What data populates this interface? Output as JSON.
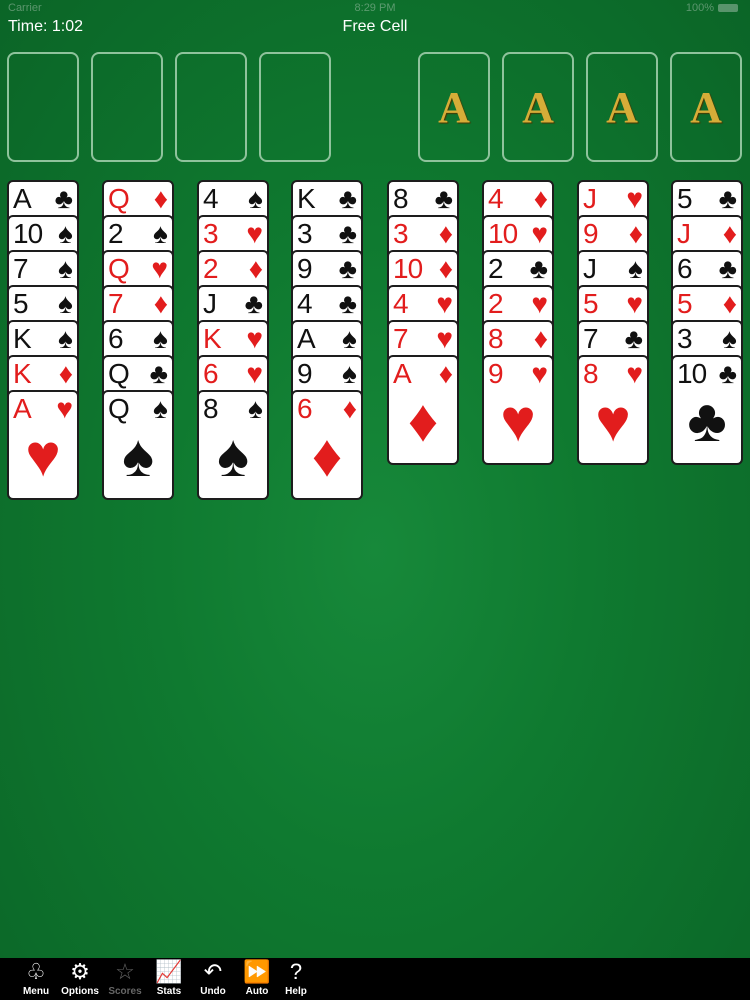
{
  "status": {
    "carrier": "Carrier",
    "time": "8:29 PM",
    "battery": "100%"
  },
  "header": {
    "timer": "Time: 1:02",
    "title": "Free Cell"
  },
  "foundations": [
    "A",
    "A",
    "A",
    "A"
  ],
  "columns": [
    [
      {
        "r": "A",
        "s": "♣"
      },
      {
        "r": "10",
        "s": "♠"
      },
      {
        "r": "7",
        "s": "♠"
      },
      {
        "r": "5",
        "s": "♠"
      },
      {
        "r": "K",
        "s": "♠"
      },
      {
        "r": "K",
        "s": "♦"
      },
      {
        "r": "A",
        "s": "♥"
      }
    ],
    [
      {
        "r": "Q",
        "s": "♦"
      },
      {
        "r": "2",
        "s": "♠"
      },
      {
        "r": "Q",
        "s": "♥"
      },
      {
        "r": "7",
        "s": "♦"
      },
      {
        "r": "6",
        "s": "♠"
      },
      {
        "r": "Q",
        "s": "♣"
      },
      {
        "r": "Q",
        "s": "♠"
      }
    ],
    [
      {
        "r": "4",
        "s": "♠"
      },
      {
        "r": "3",
        "s": "♥"
      },
      {
        "r": "2",
        "s": "♦"
      },
      {
        "r": "J",
        "s": "♣"
      },
      {
        "r": "K",
        "s": "♥"
      },
      {
        "r": "6",
        "s": "♥"
      },
      {
        "r": "8",
        "s": "♠"
      }
    ],
    [
      {
        "r": "K",
        "s": "♣"
      },
      {
        "r": "3",
        "s": "♣"
      },
      {
        "r": "9",
        "s": "♣"
      },
      {
        "r": "4",
        "s": "♣"
      },
      {
        "r": "A",
        "s": "♠"
      },
      {
        "r": "9",
        "s": "♠"
      },
      {
        "r": "6",
        "s": "♦"
      }
    ],
    [
      {
        "r": "8",
        "s": "♣"
      },
      {
        "r": "3",
        "s": "♦"
      },
      {
        "r": "10",
        "s": "♦"
      },
      {
        "r": "4",
        "s": "♥"
      },
      {
        "r": "7",
        "s": "♥"
      },
      {
        "r": "A",
        "s": "♦"
      }
    ],
    [
      {
        "r": "4",
        "s": "♦"
      },
      {
        "r": "10",
        "s": "♥"
      },
      {
        "r": "2",
        "s": "♣"
      },
      {
        "r": "2",
        "s": "♥"
      },
      {
        "r": "8",
        "s": "♦"
      },
      {
        "r": "9",
        "s": "♥"
      }
    ],
    [
      {
        "r": "J",
        "s": "♥"
      },
      {
        "r": "9",
        "s": "♦"
      },
      {
        "r": "J",
        "s": "♠"
      },
      {
        "r": "5",
        "s": "♥"
      },
      {
        "r": "7",
        "s": "♣"
      },
      {
        "r": "8",
        "s": "♥"
      }
    ],
    [
      {
        "r": "5",
        "s": "♣"
      },
      {
        "r": "J",
        "s": "♦"
      },
      {
        "r": "6",
        "s": "♣"
      },
      {
        "r": "5",
        "s": "♦"
      },
      {
        "r": "3",
        "s": "♠"
      },
      {
        "r": "10",
        "s": "♣"
      }
    ]
  ],
  "toolbar": [
    {
      "label": "Menu",
      "icon": "menu-icon",
      "glyph": "♧",
      "enabled": true
    },
    {
      "label": "Options",
      "icon": "gear-icon",
      "glyph": "⚙",
      "enabled": true
    },
    {
      "label": "Scores",
      "icon": "star-icon",
      "glyph": "☆",
      "enabled": false
    },
    {
      "label": "Stats",
      "icon": "chart-icon",
      "glyph": "📈",
      "enabled": true
    },
    {
      "label": "Undo",
      "icon": "undo-icon",
      "glyph": "↶",
      "enabled": true
    },
    {
      "label": "Auto",
      "icon": "fast-forward-icon",
      "glyph": "⏩",
      "enabled": true
    },
    {
      "label": "Help",
      "icon": "question-icon",
      "glyph": "?",
      "enabled": true
    }
  ],
  "colors": {
    "felt": "#0f7a30",
    "red": "#e21d1d",
    "black": "#111111",
    "gold": "#d6ad38"
  }
}
